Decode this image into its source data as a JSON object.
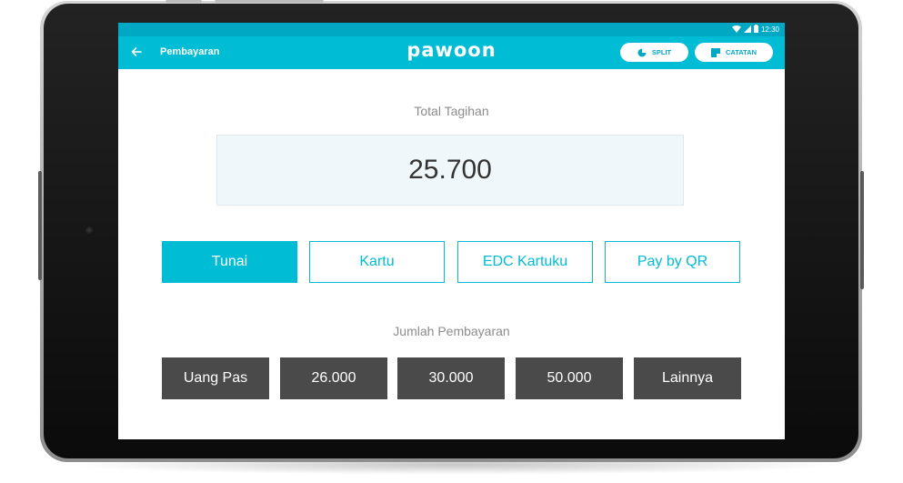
{
  "status_bar": {
    "time": "12:30"
  },
  "app_bar": {
    "title": "Pembayaran",
    "logo": "pawoon",
    "split_label": "SPLIT",
    "notes_label": "CATATAN"
  },
  "total": {
    "label": "Total Tagihan",
    "amount": "25.700"
  },
  "payment_methods": [
    {
      "label": "Tunai",
      "selected": true
    },
    {
      "label": "Kartu",
      "selected": false
    },
    {
      "label": "EDC Kartuku",
      "selected": false
    },
    {
      "label": "Pay by QR",
      "selected": false
    }
  ],
  "amount_section": {
    "label": "Jumlah Pembayaran"
  },
  "amount_options": [
    {
      "label": "Uang Pas"
    },
    {
      "label": "26.000"
    },
    {
      "label": "30.000"
    },
    {
      "label": "50.000"
    },
    {
      "label": "Lainnya"
    }
  ],
  "colors": {
    "accent": "#00bcd4",
    "status_bar": "#00a8c4",
    "amount_button": "#4a4a4a",
    "total_box": "#f0f7fa",
    "muted_text": "#8c8c8c"
  },
  "icons": {
    "back": "arrow-left-icon",
    "split": "pie-chart-icon",
    "notes": "note-icon",
    "wifi": "wifi-icon",
    "signal": "signal-icon",
    "battery": "battery-icon"
  }
}
